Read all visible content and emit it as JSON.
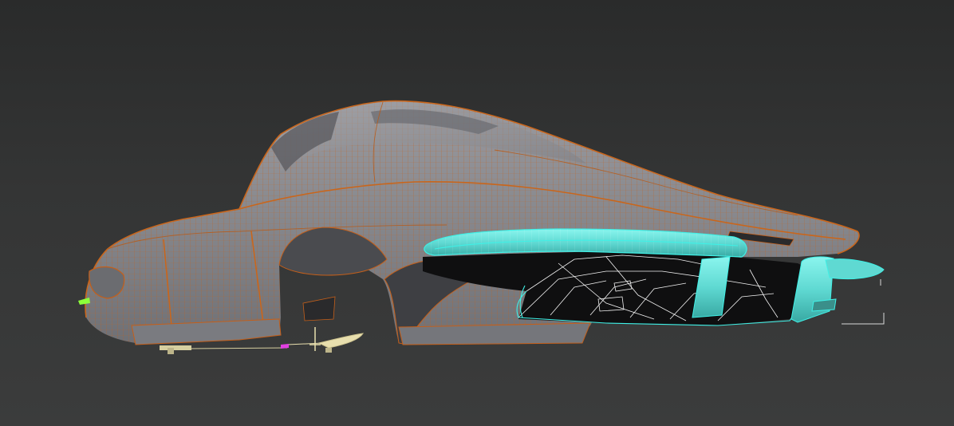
{
  "viewport": {
    "background_color": "#333434",
    "shading_mode": "wireframe-over-shaded",
    "colors": {
      "body_fill": "#8e8e92",
      "body_wire": "#c45f1a",
      "selected_wire": "#3ff0e6",
      "interior_wire": "#f2f2f2",
      "interior_fill": "#101010",
      "suspension": "#e8dfae",
      "gizmo_green": "#8cff3a",
      "gizmo_magenta": "#e040e0"
    }
  },
  "objects": [
    {
      "role": "car-body-shell",
      "state": "unselected"
    },
    {
      "role": "rear-bumper",
      "state": "selected"
    },
    {
      "role": "rear-undercarriage",
      "state": "selected"
    },
    {
      "role": "front-suspension",
      "state": "unselected"
    },
    {
      "role": "dummy-helper",
      "state": "unselected"
    }
  ]
}
